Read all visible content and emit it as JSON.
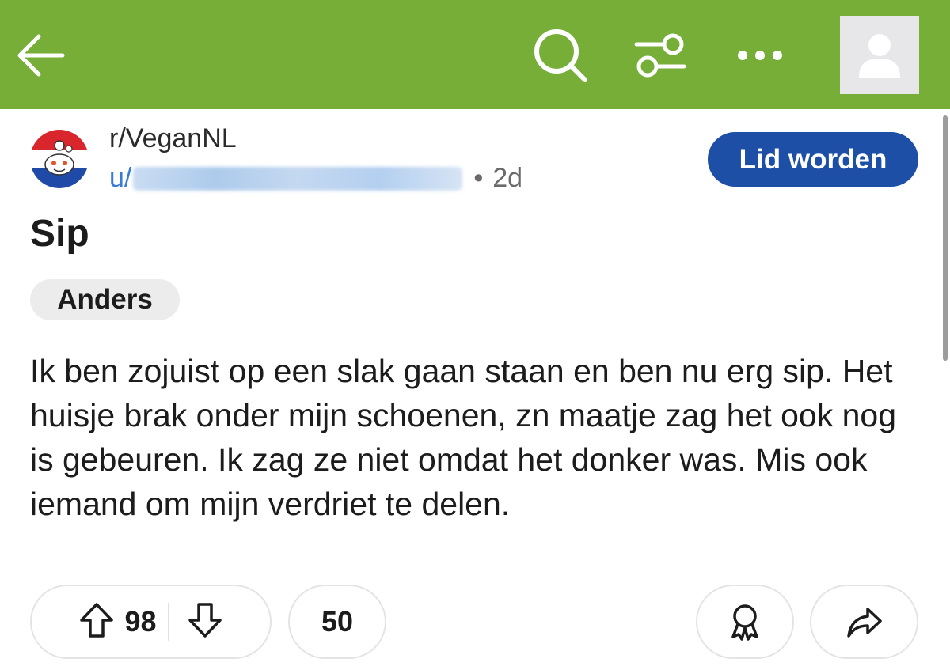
{
  "topbar": {
    "background": "#76ae38",
    "back_icon": "arrow-left-icon",
    "search_icon": "search-icon",
    "filter_icon": "filter-sliders-icon",
    "more_icon": "more-horizontal-icon",
    "avatar_icon": "user-avatar-icon"
  },
  "post": {
    "subreddit": "r/VeganNL",
    "author_prefix": "u/",
    "separator": "•",
    "time_ago": "2d",
    "join_label": "Lid worden",
    "join_color": "#1d4fa6",
    "title": "Sip",
    "flair": "Anders",
    "body": "Ik ben zojuist op een slak gaan staan en ben nu erg sip. Het huisje brak onder mijn schoenen, zn maatje zag het ook nog is gebeuren. Ik zag ze niet omdat het donker was. Mis ook iemand om mijn verdriet te delen."
  },
  "actions": {
    "upvote_icon": "arrow-up-icon",
    "score": "98",
    "downvote_icon": "arrow-down-icon",
    "comments": "50",
    "award_icon": "award-icon",
    "share_icon": "share-icon"
  }
}
